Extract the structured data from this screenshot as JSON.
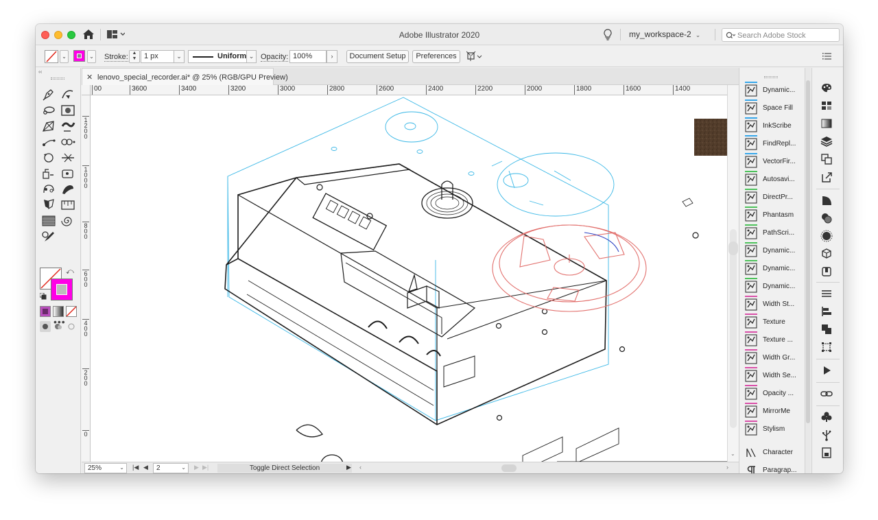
{
  "window": {
    "app_title": "Adobe Illustrator 2020",
    "workspace": "my_workspace-2",
    "stock_search_placeholder": "Search Adobe Stock"
  },
  "control_bar": {
    "stroke_label": "Stroke:",
    "stroke_weight": "1 px",
    "stroke_profile": "Uniform",
    "opacity_label": "Opacity:",
    "opacity_value": "100%",
    "document_setup": "Document Setup",
    "preferences": "Preferences",
    "fill_color": "#ff00e6"
  },
  "document": {
    "tab_title": "lenovo_special_recorder.ai* @ 25% (RGB/GPU Preview)",
    "close_symbol": "✕"
  },
  "ruler": {
    "horizontal": [
      "00",
      "3600",
      "3400",
      "3200",
      "3000",
      "2800",
      "2600",
      "2400",
      "2200",
      "2000",
      "1800",
      "1600",
      "1400"
    ],
    "vertical": [
      "1\n2\n0\n0",
      "1\n0\n0\n0",
      "8\n0\n0",
      "6\n0\n0",
      "4\n0\n0",
      "2\n0\n0",
      "0"
    ]
  },
  "status_bar": {
    "zoom": "25%",
    "page": "2",
    "status_text": "Toggle Direct Selection"
  },
  "plugins": [
    {
      "label": "Dynamic...",
      "icon": "dynamic-sketch-icon",
      "accent": "#35a6ea"
    },
    {
      "label": "Space Fill",
      "icon": "space-fill-icon",
      "accent": "#35a6ea"
    },
    {
      "label": "InkScribe",
      "icon": "inkscribe-pen-icon",
      "accent": "#35a6ea"
    },
    {
      "label": "FindRepl...",
      "icon": "find-replace-icon",
      "accent": "#35a6ea"
    },
    {
      "label": "VectorFir...",
      "icon": "vector-first-aid-icon",
      "accent": "#35a6ea"
    },
    {
      "label": "Autosavi...",
      "icon": "autosave-clock-icon",
      "accent": "#4cc25a"
    },
    {
      "label": "DirectPr...",
      "icon": "direct-prefs-icon",
      "accent": "#4cc25a"
    },
    {
      "label": "Phantasm",
      "icon": "phantasm-sun-icon",
      "accent": "#4cc25a"
    },
    {
      "label": "PathScri...",
      "icon": "path-scribe-icon",
      "accent": "#4cc25a"
    },
    {
      "label": "Dynamic...",
      "icon": "dynamic-corners-icon",
      "accent": "#4cc25a"
    },
    {
      "label": "Dynamic...",
      "icon": "dynamic-measure-icon",
      "accent": "#4cc25a"
    },
    {
      "label": "Dynamic...",
      "icon": "dynamic-ruler-icon",
      "accent": "#4cc25a"
    },
    {
      "label": "Width St...",
      "icon": "width-stripes-icon",
      "accent": "#d94fa8"
    },
    {
      "label": "Texture",
      "icon": "texture-icon",
      "accent": "#d94fa8"
    },
    {
      "label": "Texture ...",
      "icon": "texture-hatch-icon",
      "accent": "#d94fa8"
    },
    {
      "label": "Width Gr...",
      "icon": "width-graph-icon",
      "accent": "#d94fa8"
    },
    {
      "label": "Width Se...",
      "icon": "width-select-icon",
      "accent": "#d94fa8"
    },
    {
      "label": "Opacity ...",
      "icon": "opacity-brush-icon",
      "accent": "#d94fa8"
    },
    {
      "label": "MirrorMe",
      "icon": "mirrorme-butterfly-icon",
      "accent": "#d94fa8"
    },
    {
      "label": "Stylism",
      "icon": "stylism-swirl-icon",
      "accent": "#d94fa8"
    },
    {
      "label": "Character",
      "icon": "character-icon",
      "accent": ""
    },
    {
      "label": "Paragrap...",
      "icon": "paragraph-icon",
      "accent": ""
    }
  ]
}
